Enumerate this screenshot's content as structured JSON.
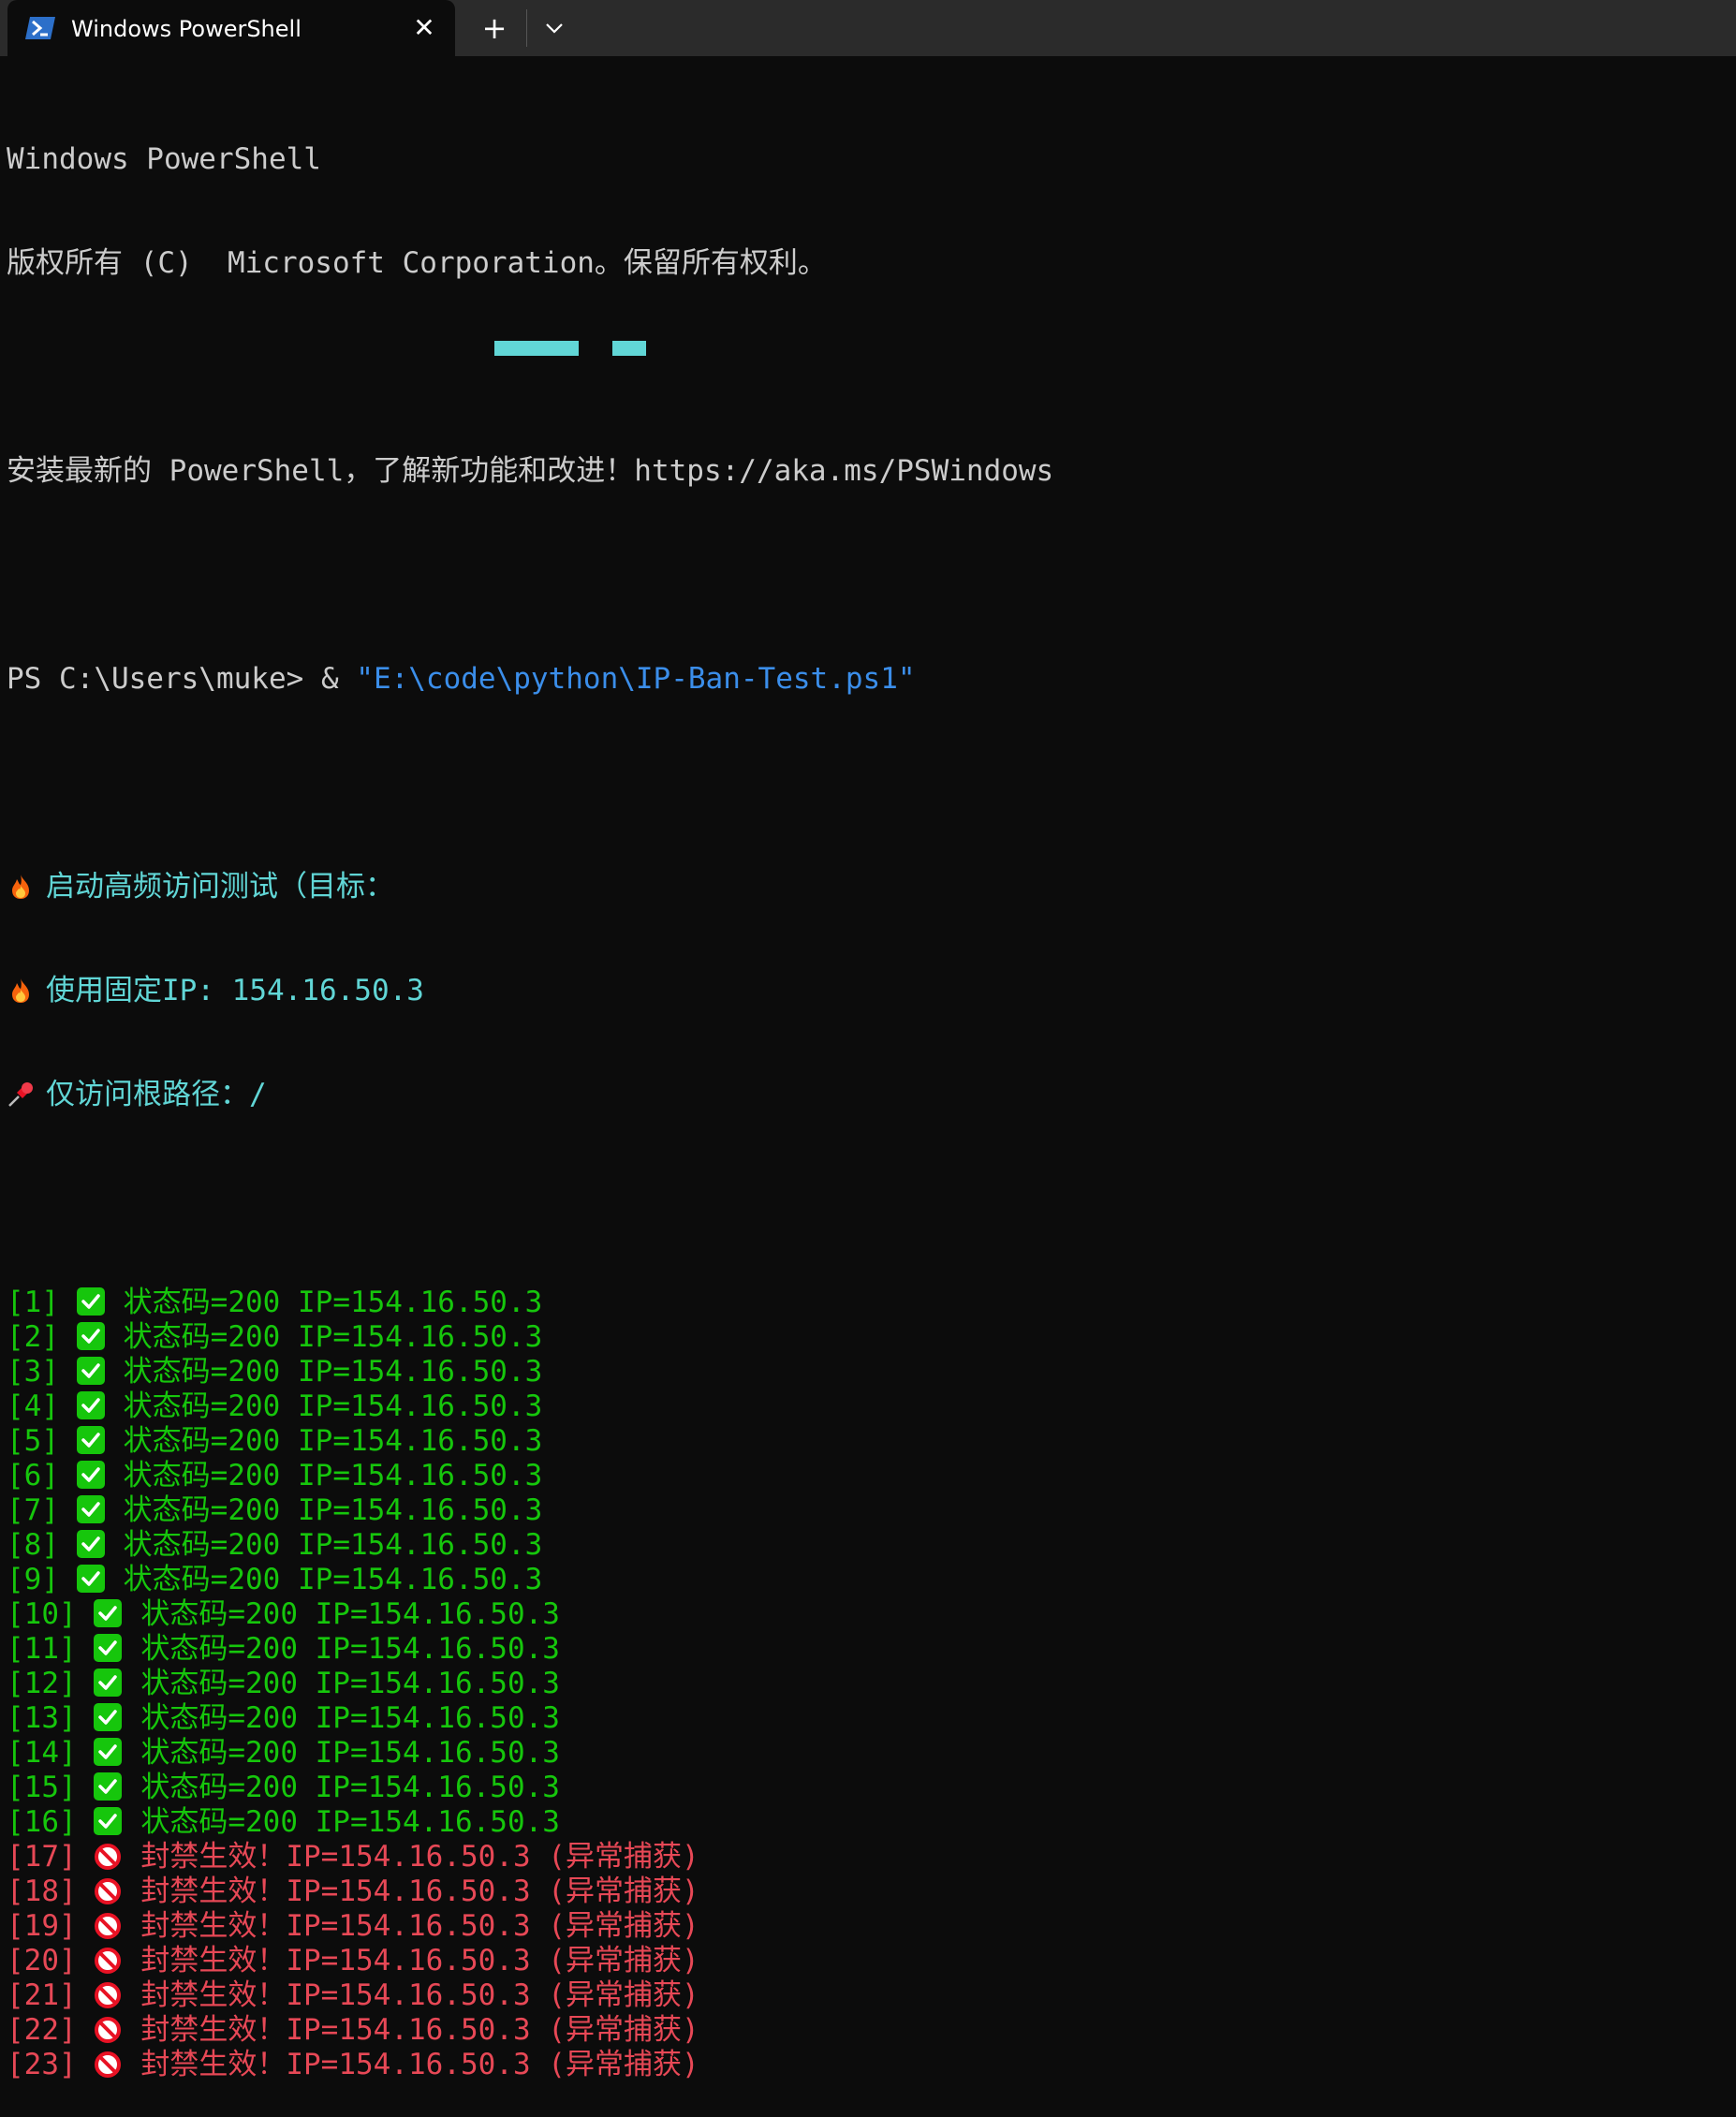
{
  "window": {
    "tab_title": "Windows PowerShell",
    "new_tab_label": "+",
    "close_label": "✕"
  },
  "header": {
    "line1": "Windows PowerShell",
    "line2": "版权所有 (C)  Microsoft Corporation。保留所有权利。",
    "line3": "安装最新的 PowerShell，了解新功能和改进！https://aka.ms/PSWindows"
  },
  "prompt": {
    "prefix": "PS C:\\Users\\muke> & ",
    "command": "\"E:\\code\\python\\IP-Ban-Test.ps1\""
  },
  "info": {
    "start": "启动高频访问测试（目标：",
    "fixed_ip": "使用固定IP: 154.16.50.3",
    "root_path": "仅访问根路径：/"
  },
  "results": [
    {
      "index": "[1]",
      "ok": true,
      "text": "状态码=200 IP=154.16.50.3"
    },
    {
      "index": "[2]",
      "ok": true,
      "text": "状态码=200 IP=154.16.50.3"
    },
    {
      "index": "[3]",
      "ok": true,
      "text": "状态码=200 IP=154.16.50.3"
    },
    {
      "index": "[4]",
      "ok": true,
      "text": "状态码=200 IP=154.16.50.3"
    },
    {
      "index": "[5]",
      "ok": true,
      "text": "状态码=200 IP=154.16.50.3"
    },
    {
      "index": "[6]",
      "ok": true,
      "text": "状态码=200 IP=154.16.50.3"
    },
    {
      "index": "[7]",
      "ok": true,
      "text": "状态码=200 IP=154.16.50.3"
    },
    {
      "index": "[8]",
      "ok": true,
      "text": "状态码=200 IP=154.16.50.3"
    },
    {
      "index": "[9]",
      "ok": true,
      "text": "状态码=200 IP=154.16.50.3"
    },
    {
      "index": "[10]",
      "ok": true,
      "text": "状态码=200 IP=154.16.50.3"
    },
    {
      "index": "[11]",
      "ok": true,
      "text": "状态码=200 IP=154.16.50.3"
    },
    {
      "index": "[12]",
      "ok": true,
      "text": "状态码=200 IP=154.16.50.3"
    },
    {
      "index": "[13]",
      "ok": true,
      "text": "状态码=200 IP=154.16.50.3"
    },
    {
      "index": "[14]",
      "ok": true,
      "text": "状态码=200 IP=154.16.50.3"
    },
    {
      "index": "[15]",
      "ok": true,
      "text": "状态码=200 IP=154.16.50.3"
    },
    {
      "index": "[16]",
      "ok": true,
      "text": "状态码=200 IP=154.16.50.3"
    },
    {
      "index": "[17]",
      "ok": false,
      "text": "封禁生效！IP=154.16.50.3 (异常捕获)"
    },
    {
      "index": "[18]",
      "ok": false,
      "text": "封禁生效！IP=154.16.50.3 (异常捕获)"
    },
    {
      "index": "[19]",
      "ok": false,
      "text": "封禁生效！IP=154.16.50.3 (异常捕获)"
    },
    {
      "index": "[20]",
      "ok": false,
      "text": "封禁生效！IP=154.16.50.3 (异常捕获)"
    },
    {
      "index": "[21]",
      "ok": false,
      "text": "封禁生效！IP=154.16.50.3 (异常捕获)"
    },
    {
      "index": "[22]",
      "ok": false,
      "text": "封禁生效！IP=154.16.50.3 (异常捕获)"
    },
    {
      "index": "[23]",
      "ok": false,
      "text": "封禁生效！IP=154.16.50.3 (异常捕获)"
    }
  ],
  "colors": {
    "background": "#0c0c0c",
    "success": "#16c60c",
    "error": "#e74856",
    "info": "#61d6d6",
    "command": "#3b8eea"
  }
}
